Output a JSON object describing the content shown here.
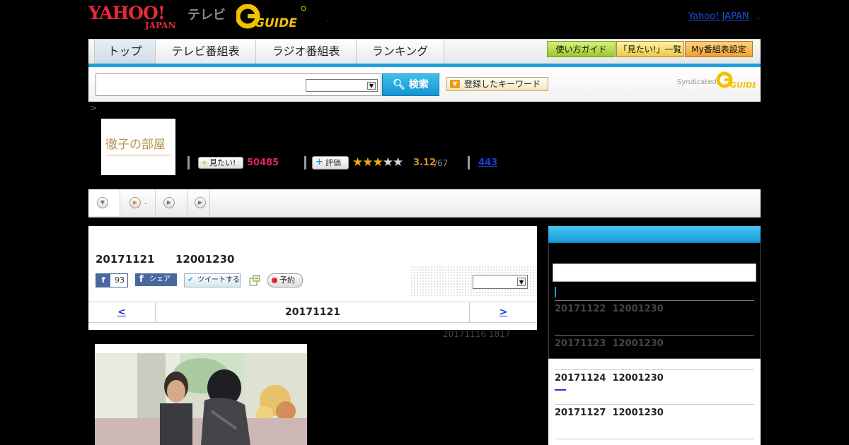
{
  "header": {
    "yahoo_logo_text": "YAHOO!",
    "yahoo_sub_text": "JAPAN",
    "tv_text": "テレビ",
    "gguide_text": "GUIDE",
    "dot_text": ",",
    "yj_link": "Yahoo! JAPAN"
  },
  "nav": {
    "tabs": [
      "トップ",
      "テレビ番組表",
      "ラジオ番組表",
      "ランキング"
    ],
    "guide_btn": "使い方ガイド",
    "mitai_list_btn": "「見たい!」一覧",
    "my_bangumi_btn": "My番組表設定"
  },
  "search": {
    "button_label": "検索",
    "keyword_button": "登録したキーワード",
    "syndicated": "Syndicated"
  },
  "breadcrumb": ">",
  "program": {
    "thumb_title": "徹子の部屋",
    "mitai_label": "見たい!",
    "mitai_count": "50485",
    "eval_label": "評価",
    "rating": 3.12,
    "rating_text": "3.12",
    "rating_count": "/67",
    "rate_link": "443"
  },
  "subtabs": {
    "tab2_suffix": "."
  },
  "episode": {
    "date": "20171121",
    "time": "12001230",
    "fb_count": "93",
    "fb_share": "シェア",
    "tweet": "ツイートする",
    "yoyaku": "予約",
    "nav_prev": "<",
    "nav_date": "20171121",
    "nav_next": ">",
    "updated": "20171116  1817"
  },
  "sidebar": {
    "items": [
      {
        "date": "20171122",
        "time": "12001230"
      },
      {
        "date": "20171123",
        "time": "12001230"
      },
      {
        "date": "20171124",
        "time": "12001230"
      },
      {
        "date": "20171127",
        "time": "12001230"
      }
    ]
  },
  "colors": {
    "accent_blue": "#1ea0dc",
    "mitai_pink": "#e0245e",
    "rating_orange": "#e38a12",
    "link_blue": "#1a3cd6"
  }
}
